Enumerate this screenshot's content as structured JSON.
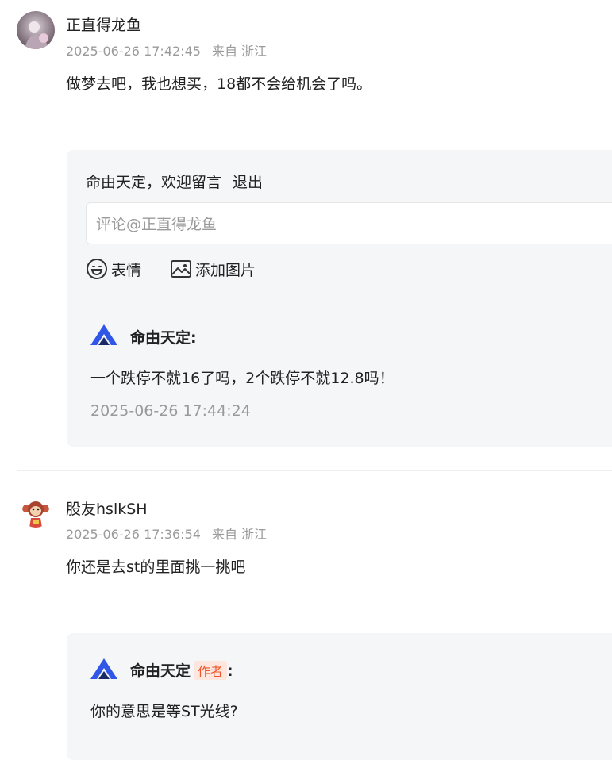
{
  "colors": {
    "text": "#222222",
    "meta": "#9a9a9a",
    "panel_bg": "#f5f6f7",
    "author_badge_bg": "#fde6de",
    "author_badge_text": "#f0562c",
    "logo_blue": "#2f56e6"
  },
  "comments": [
    {
      "username": "正直得龙鱼",
      "time": "2025-06-26 17:42:45",
      "location": "来自 浙江",
      "text": "做梦去吧，我也想买，18都不会给机会了吗。",
      "avatar_icon": "user-photo-avatar"
    },
    {
      "username": "股友hslkSH",
      "time": "2025-06-26 17:36:54",
      "location": "来自 浙江",
      "text": "你还是去st的里面挑一挑吧",
      "avatar_icon": "monkey-avatar"
    }
  ],
  "reply_box": {
    "welcome": "命由天定，欢迎留言",
    "logout": "退出",
    "placeholder": "评论@正直得龙鱼",
    "emoji_label": "表情",
    "add_image_label": "添加图片"
  },
  "replies": [
    {
      "name": "命由天定:",
      "text": "一个跌停不就16了吗，2个跌停不就12.8吗！",
      "time": "2025-06-26 17:44:24"
    },
    {
      "name": "命由天定",
      "badge": "作者",
      "colon": ":",
      "text": "你的意思是等ST光线?"
    }
  ]
}
